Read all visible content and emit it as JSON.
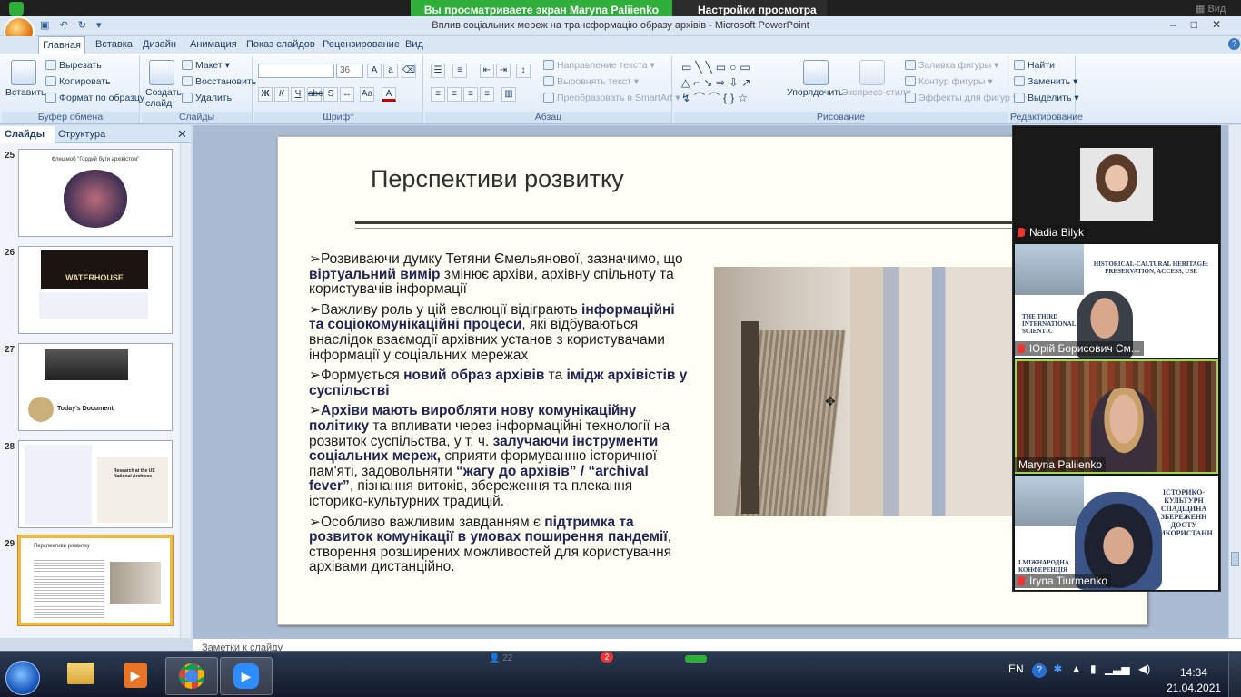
{
  "zoom": {
    "share_banner": "Вы просматриваете экран Maryna Paliienko",
    "view_options": "Настройки просмотра",
    "top_right_view": "Вид"
  },
  "window": {
    "title": "Вплив соціальних мереж на трансформацію образу архівів - Microsoft PowerPoint"
  },
  "ribbon": {
    "tabs": [
      "Главная",
      "Вставка",
      "Дизайн",
      "Анимация",
      "Показ слайдов",
      "Рецензирование",
      "Вид"
    ],
    "clipboard": {
      "label": "Буфер обмена",
      "paste": "Вставить",
      "cut": "Вырезать",
      "copy": "Копировать",
      "format_painter": "Формат по образцу"
    },
    "slides": {
      "label": "Слайды",
      "new_slide": "Создать слайд",
      "layout": "Макет",
      "reset": "Восстановить",
      "delete": "Удалить"
    },
    "font": {
      "label": "Шрифт",
      "size": "36"
    },
    "paragraph": {
      "label": "Абзац",
      "text_direction": "Направление текста",
      "align_text": "Выровнять текст",
      "smartart": "Преобразовать в SmartArt"
    },
    "drawing": {
      "label": "Рисование",
      "arrange": "Упорядочить",
      "quick_styles": "Экспресс-стили",
      "shape_fill": "Заливка фигуры",
      "shape_outline": "Контур фигуры",
      "shape_effects": "Эффекты для фигур"
    },
    "editing": {
      "label": "Редактирование",
      "find": "Найти",
      "replace": "Заменить",
      "select": "Выделить"
    }
  },
  "left_panel": {
    "tab_slides": "Слайды",
    "tab_outline": "Структура",
    "thumbnails": [
      {
        "number": "25",
        "caption": "Флешмоб \"Гордий бути архівістом\""
      },
      {
        "number": "26",
        "caption": "WATERHOUSE"
      },
      {
        "number": "27",
        "caption": "Today's Document"
      },
      {
        "number": "28",
        "caption": "Research at the US National Archives"
      },
      {
        "number": "29",
        "caption": "Перспективи розвитку"
      }
    ]
  },
  "slide": {
    "title": "Перспективи розвитку",
    "bullets": [
      [
        {
          "t": "➢Розвиваючи думку Тетяни Ємельянової, зазначимо, що "
        },
        {
          "b": "віртуальний вимір"
        },
        {
          "t": " змінює архіви, архівну спільноту та користувачів інформації"
        }
      ],
      [
        {
          "t": "➢Важливу роль у цій еволюції відіграють "
        },
        {
          "b": "інформаційні та соціокомунікаційні процеси"
        },
        {
          "t": ", які відбуваються внаслідок взаємодії архівних установ з користувачами інформації у соціальних мережах"
        }
      ],
      [
        {
          "t": "➢Формується "
        },
        {
          "b": "новий образ архівів"
        },
        {
          "t": " та "
        },
        {
          "b": "імідж архівістів у суспільстві"
        }
      ],
      [
        {
          "t": "➢"
        },
        {
          "b": "Архіви мають виробляти нову комунікаційну політику"
        },
        {
          "t": " та впливати через інформаційні технології на розвиток суспільства, у т. ч. "
        },
        {
          "b": "залучаючи інструменти соціальних мереж,"
        },
        {
          "t": " сприяти формуванню історичної пам'яті, задовольняти "
        },
        {
          "b": "“жагу до архівів” / “archival fever”"
        },
        {
          "t": ", пізнання витоків, збереження та плекання історико-культурних традицій."
        }
      ],
      [
        {
          "t": "➢Особливо важливим завданням є "
        },
        {
          "b": "підтримка та розвиток комунікації в умовах поширення пандемії"
        },
        {
          "t": ", створення розширених можливостей для користування архівами дистанційно."
        }
      ]
    ]
  },
  "notes_label": "Заметки к слайду",
  "video": {
    "participants": [
      {
        "name": "Nadia Bilyk",
        "muted": true
      },
      {
        "name": "Юрій Борисович См...",
        "muted": true,
        "background_text": "HISTORICAL-CALTURAL HERITAGE: PRESERVATION, ACCESS, USE",
        "background_text2": "THE THIRD INTERNATIONAL SCIENTIC"
      },
      {
        "name": "Maryna Paliienko",
        "muted": false,
        "speaking": true
      },
      {
        "name": "Iryna Tiurmenko",
        "muted": true,
        "background_text": "ІСТОРИКО-КУЛЬТУРН СПАДЩИНА ЗБЕРЕЖЕНН ДОСТУ ВИКОРИСТАНН",
        "background_text2": "І МІЖНАРОДНА КОНФЕРЕНЦІЯ"
      }
    ]
  },
  "taskbar": {
    "language": "EN",
    "time": "14:34",
    "date": "21.04.2021",
    "zoom_chat_badge": "2",
    "participants_count": "22"
  },
  "colors": {
    "zoom_green": "#2fae3c",
    "ribbon_bg": "#dfeaf7",
    "slide_bg": "#fffff6",
    "body_emphasis": "#1f2455",
    "active_speaker": "#9bd64b"
  }
}
